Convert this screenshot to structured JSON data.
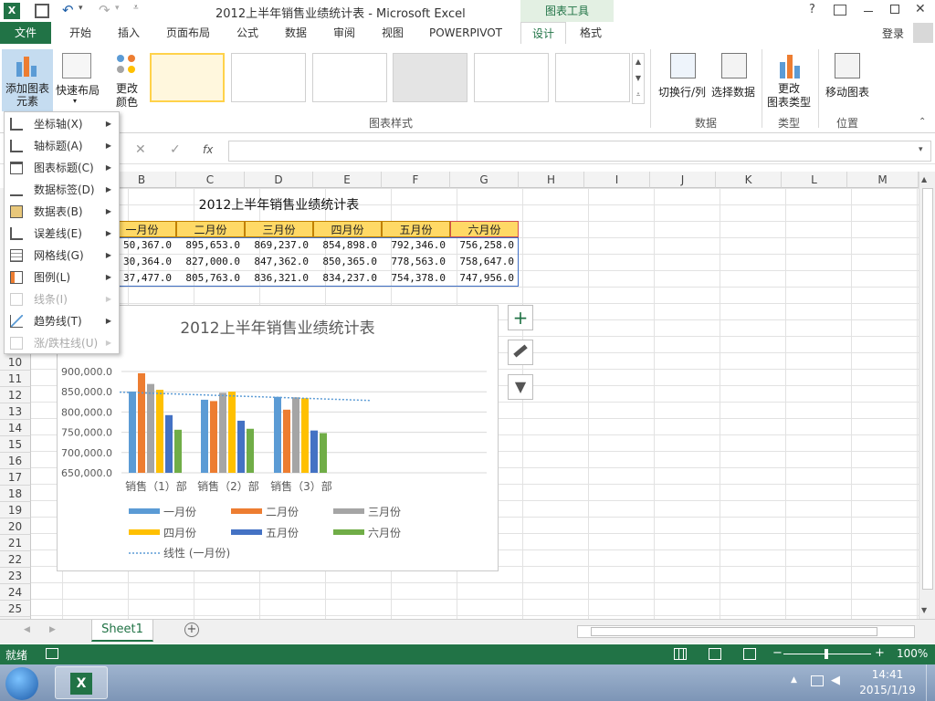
{
  "window": {
    "title": "2012上半年销售业绩统计表 - Microsoft Excel",
    "context_tab_group": "图表工具",
    "help": "?",
    "login": "登录"
  },
  "tabs": [
    "文件",
    "开始",
    "插入",
    "页面布局",
    "公式",
    "数据",
    "审阅",
    "视图",
    "POWERPIVOT",
    "设计",
    "格式"
  ],
  "ribbon": {
    "add_element": [
      "添加图表",
      "元素"
    ],
    "quick_layout": "快速布局",
    "change_color": [
      "更改",
      "颜色"
    ],
    "styles_group": "图表样式",
    "switch_rowcol": "切换行/列",
    "select_data": "选择数据",
    "data_group": "数据",
    "change_type": [
      "更改",
      "图表类型"
    ],
    "type_group": "类型",
    "move_chart": "移动图表",
    "location_group": "位置"
  },
  "formula_bar": {
    "fx": "fx",
    "cancel": "✕",
    "enter": "✓",
    "value": ""
  },
  "menu": [
    {
      "label": "坐标轴(X)",
      "icon": "axis-icon",
      "enabled": true
    },
    {
      "label": "轴标题(A)",
      "icon": "axis-title-icon",
      "enabled": true
    },
    {
      "label": "图表标题(C)",
      "icon": "chart-title-icon",
      "enabled": true
    },
    {
      "label": "数据标签(D)",
      "icon": "data-labels-icon",
      "enabled": true
    },
    {
      "label": "数据表(B)",
      "icon": "data-table-icon",
      "enabled": true
    },
    {
      "label": "误差线(E)",
      "icon": "error-bars-icon",
      "enabled": true
    },
    {
      "label": "网格线(G)",
      "icon": "gridlines-icon",
      "enabled": true
    },
    {
      "label": "图例(L)",
      "icon": "legend-icon",
      "enabled": true
    },
    {
      "label": "线条(I)",
      "icon": "lines-icon",
      "enabled": false
    },
    {
      "label": "趋势线(T)",
      "icon": "trendline-icon",
      "enabled": true
    },
    {
      "label": "涨/跌柱线(U)",
      "icon": "up-down-bars-icon",
      "enabled": false
    }
  ],
  "columns": [
    "B",
    "C",
    "D",
    "E",
    "F",
    "G",
    "H",
    "I",
    "J",
    "K",
    "L",
    "M"
  ],
  "rows": [
    "10",
    "11",
    "12",
    "13",
    "14",
    "15",
    "16",
    "17",
    "18",
    "19",
    "20",
    "21",
    "22",
    "23",
    "24",
    "25"
  ],
  "sheet": {
    "title": "2012上半年销售业绩统计表",
    "headers": [
      "一月份",
      "二月份",
      "三月份",
      "四月份",
      "五月份",
      "六月份"
    ],
    "rows": [
      [
        "50,367.0",
        "895,653.0",
        "869,237.0",
        "854,898.0",
        "792,346.0",
        "756,258.0"
      ],
      [
        "30,364.0",
        "827,000.0",
        "847,362.0",
        "850,365.0",
        "778,563.0",
        "758,647.0"
      ],
      [
        "37,477.0",
        "805,763.0",
        "836,321.0",
        "834,237.0",
        "754,378.0",
        "747,956.0"
      ]
    ]
  },
  "sheet_tab": "Sheet1",
  "status": {
    "ready": "就绪",
    "zoom": "100%"
  },
  "taskbar": {
    "time": "14:41",
    "date": "2015/1/19"
  },
  "chart_data": {
    "type": "bar",
    "title": "2012上半年销售业绩统计表",
    "categories": [
      "销售（1）部",
      "销售（2）部",
      "销售（3）部"
    ],
    "y_ticks": [
      "900,000.0",
      "850,000.0",
      "800,000.0",
      "750,000.0",
      "700,000.0",
      "650,000.0"
    ],
    "ylim": [
      650000,
      900000
    ],
    "series": [
      {
        "name": "一月份",
        "color": "#5b9bd5",
        "values": [
          850367,
          830364,
          837477
        ]
      },
      {
        "name": "二月份",
        "color": "#ed7d31",
        "values": [
          895653,
          827000,
          805763
        ]
      },
      {
        "name": "三月份",
        "color": "#a5a5a5",
        "values": [
          869237,
          847362,
          836321
        ]
      },
      {
        "name": "四月份",
        "color": "#ffc000",
        "values": [
          854898,
          850365,
          834237
        ]
      },
      {
        "name": "五月份",
        "color": "#4472c4",
        "values": [
          792346,
          778563,
          754378
        ]
      },
      {
        "name": "六月份",
        "color": "#70ad47",
        "values": [
          756258,
          758647,
          747956
        ]
      }
    ],
    "trendline": {
      "name": "线性 (一月份)",
      "color": "#5b9bd5"
    },
    "grid": true,
    "legend": "bottom"
  }
}
